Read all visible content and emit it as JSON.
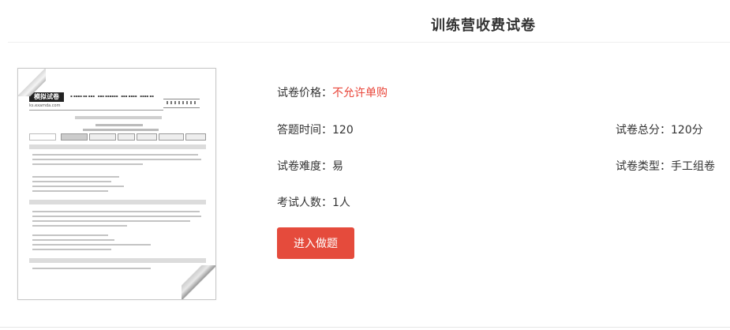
{
  "page": {
    "title": "训练营收费试卷"
  },
  "thumbnail": {
    "logo": "模拟试卷",
    "site": "ks.examda.com"
  },
  "info": {
    "price_label": "试卷价格：",
    "price_value": "不允许单购",
    "time_label": "答题时间：",
    "time_value": "120",
    "score_label": "试卷总分：",
    "score_value": "120分",
    "difficulty_label": "试卷难度：",
    "difficulty_value": "易",
    "type_label": "试卷类型：",
    "type_value": "手工组卷",
    "people_label": "考试人数：",
    "people_value": "1人"
  },
  "actions": {
    "enter_label": "进入做题"
  },
  "colors": {
    "accent": "#e54b3c",
    "price_text": "#e9473b"
  }
}
